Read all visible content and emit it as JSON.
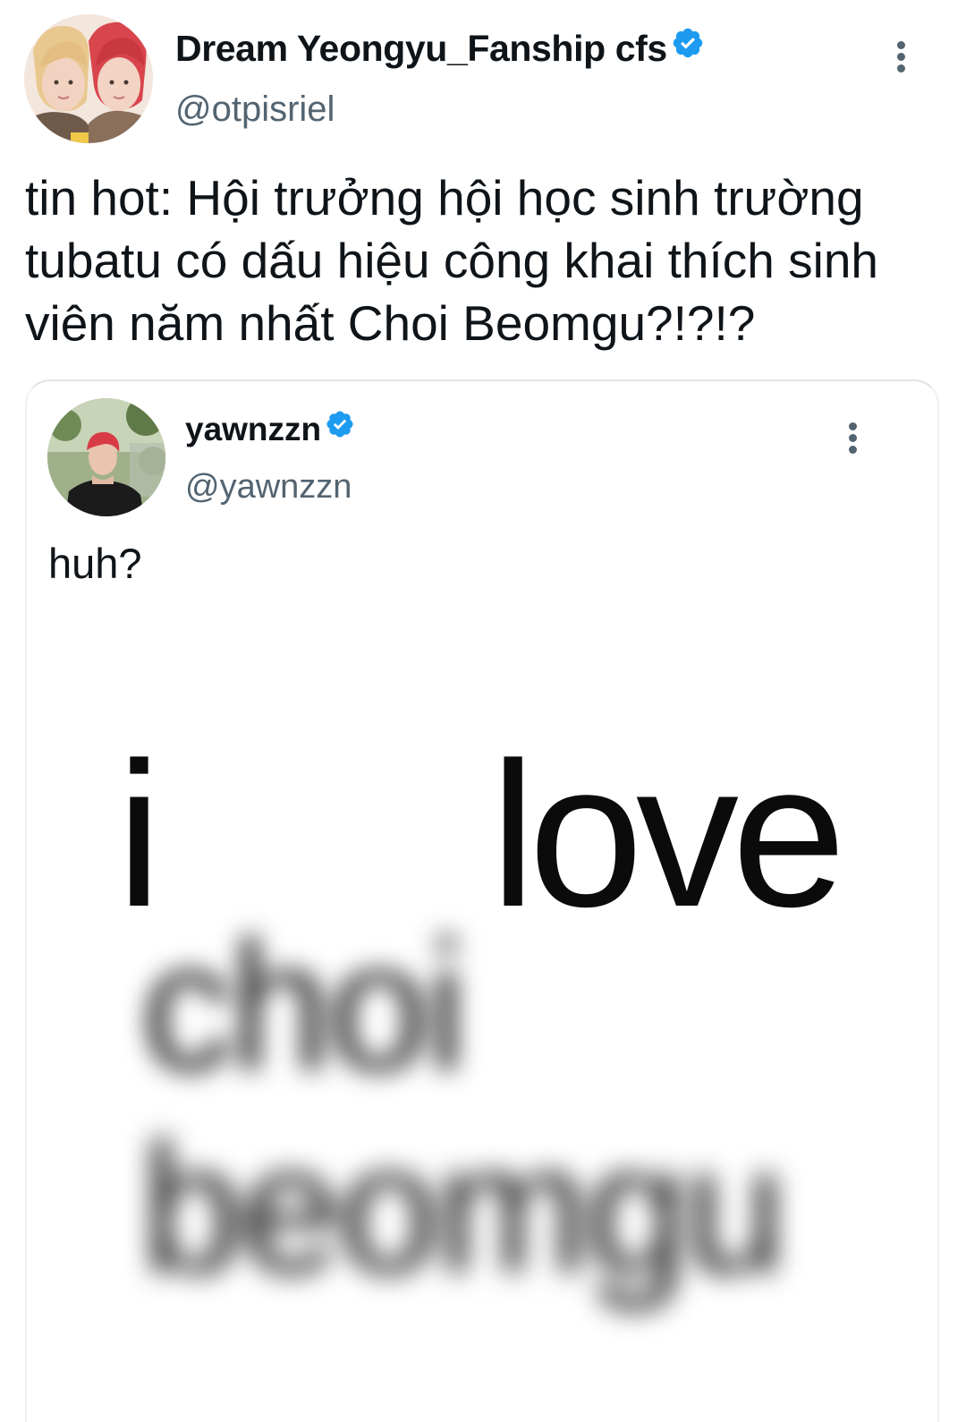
{
  "tweet": {
    "author": {
      "display_name": "Dream Yeongyu_Fanship cfs",
      "handle": "@otpisriel",
      "verified": true,
      "avatar_icon": "avatar-two-people-photo"
    },
    "text": "tin hot: Hội trưởng hội học sinh trường tubatu có dấu hiệu công khai thích sinh viên năm nhất Choi Beomgu?!?!?",
    "more_icon": "more-vertical-icon"
  },
  "quoted_tweet": {
    "author": {
      "display_name": "yawnzzn",
      "handle": "@yawnzzn",
      "verified": true,
      "avatar_icon": "avatar-red-hair-photo"
    },
    "text": "huh?",
    "more_icon": "more-vertical-icon",
    "image": {
      "words": {
        "word1": "i",
        "word2": "love",
        "word3_blurred": "choi",
        "word4_blurred": "beomgu"
      }
    }
  },
  "colors": {
    "verified_blue": "#1d9bf0",
    "text_primary": "#0f1419",
    "text_secondary": "#536471",
    "divider": "#dfe3e6"
  }
}
